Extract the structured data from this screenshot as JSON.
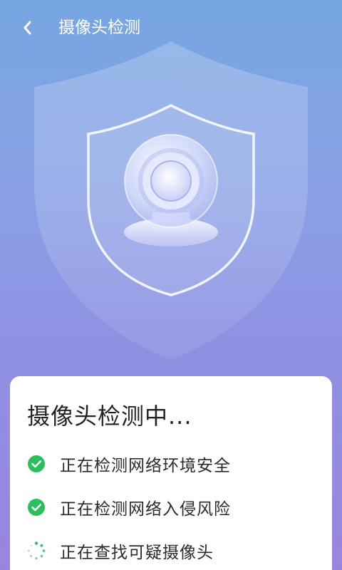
{
  "header": {
    "title": "摄像头检测",
    "back_icon": "chevron-left-icon"
  },
  "status": {
    "title": "摄像头检测中..."
  },
  "checks": [
    {
      "label": "正在检测网络环境安全",
      "state": "done",
      "icon": "check-circle-icon"
    },
    {
      "label": "正在检测网络入侵风险",
      "state": "done",
      "icon": "check-circle-icon"
    },
    {
      "label": "正在查找可疑摄像头",
      "state": "loading",
      "icon": "spinner-icon"
    }
  ],
  "colors": {
    "accent_green": "#2bbf5b",
    "card": "#ffffff",
    "text": "#222222"
  }
}
